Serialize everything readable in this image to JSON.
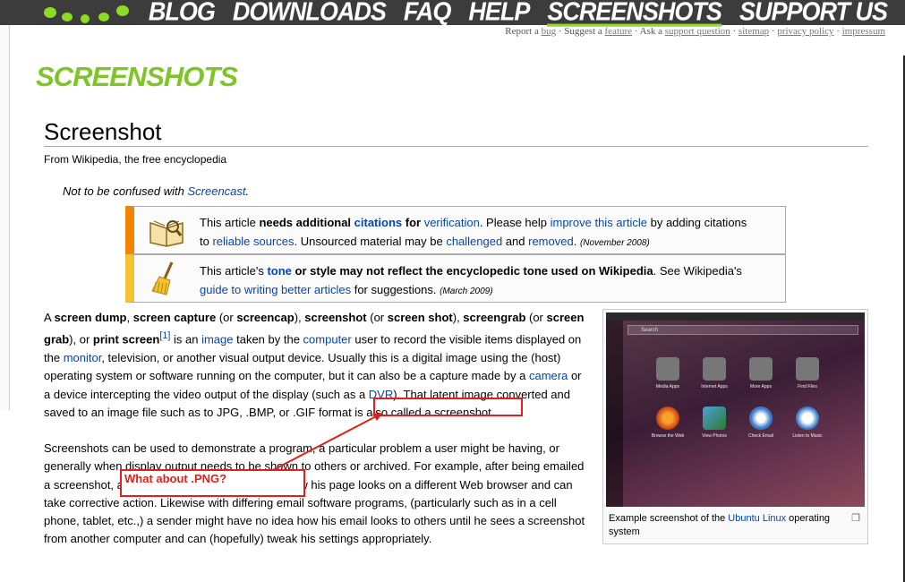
{
  "nav": {
    "items": [
      "BLOG",
      "DOWNLOADS",
      "FAQ",
      "HELP",
      "SCREENSHOTS",
      "SUPPORT US"
    ],
    "active_index": 4
  },
  "sublinks": {
    "report_prefix": "Report a",
    "bug": "bug",
    "suggest_prefix": "· Suggest a",
    "feature": "feature",
    "ask_prefix": "· Ask a",
    "support_question": "support question",
    "sitemap": "sitemap",
    "privacy_policy": "privacy policy",
    "impressum": "impressum",
    "sep": "·"
  },
  "page_heading": "SCREENSHOTS",
  "wikipedia": {
    "title": "Screenshot",
    "tagline": "From Wikipedia, the free encyclopedia",
    "hatnote_prefix": "Not to be confused with",
    "hatnote_link": "Screencast",
    "hatnote_suffix": ".",
    "ambox1": {
      "t1": "This article ",
      "b1": "needs additional ",
      "l1": "citations",
      "b2": " for ",
      "l2": "verification",
      "t2": ". Please help ",
      "l3": "improve this article",
      "t3": " by adding citations to ",
      "l4": "reliable sources",
      "t4": ". Unsourced material may be ",
      "l5": "challenged",
      "t5": " and ",
      "l6": "removed",
      "t6": ". ",
      "date": "(November 2008)"
    },
    "ambox2": {
      "t1": "This article's ",
      "l1": "tone",
      "b1": " or style may not reflect the encyclopedic tone used on Wikipedia",
      "t2": ". See Wikipedia's ",
      "l2": "guide to writing better articles",
      "t3": " for suggestions. ",
      "date": "(March 2009)"
    },
    "para1": {
      "s1": "A ",
      "b1": "screen dump",
      "s2": ", ",
      "b2": "screen capture",
      "s3": " (or ",
      "b3": "screencap",
      "s4": "), ",
      "b4": "screenshot",
      "s5": " (or ",
      "b5": "screen shot",
      "s6": "), ",
      "b6": "screengrab",
      "s7": " (or ",
      "b7": "screen grab",
      "s8": "), or ",
      "b8": "print screen",
      "ref": "[1]",
      "s9": " is an ",
      "l1": "image",
      "s10": " taken by the ",
      "l2": "computer",
      "s11": " user to record the visible items displayed on the ",
      "l3": "monitor",
      "s12": ", television, or another visual output device. Usually this is a digital image using the (host) operating system or software running on the computer, but it can also be a capture made by a ",
      "l4": "camera",
      "s13": " or a device intercepting the video output of the display (such as a ",
      "l5": "DVR",
      "s14": "). That latent image converted and saved to an image file such as to JPG, .BMP, or .GIF format is also called a screenshot."
    },
    "para2": "Screenshots can be used to demonstrate a program, a particular problem a user might be having, or generally when display output needs to be shown to others or archived. For example, after being emailed a screenshot, a user might be surprised to see how his page looks on a different Web browser and can take corrective action. Likewise with differing email software programs, (particularly such as in a cell phone, tablet, etc.,) a sender might have no idea how his email looks to others until he sees a screenshot from another computer and can (hopefully) tweak his settings appropriately.",
    "thumb": {
      "caption_prefix": "Example screenshot of the ",
      "caption_link": "Ubuntu Linux",
      "caption_suffix": " operating system",
      "search_placeholder": "Search",
      "apps": [
        "Media Apps",
        "Internet Apps",
        "More Apps",
        "Find Files",
        "Browse the Web",
        "View Photos",
        "Check Email",
        "Listen to Music"
      ]
    }
  },
  "annotation": {
    "callout_text": "What about .PNG?",
    "highlight_color": "#e0201c"
  },
  "colors": {
    "brand_green": "#8bdc22",
    "heading_green": "#7fc52a",
    "topbar": "#3c3c3c",
    "link_blue": "#0645ad"
  }
}
